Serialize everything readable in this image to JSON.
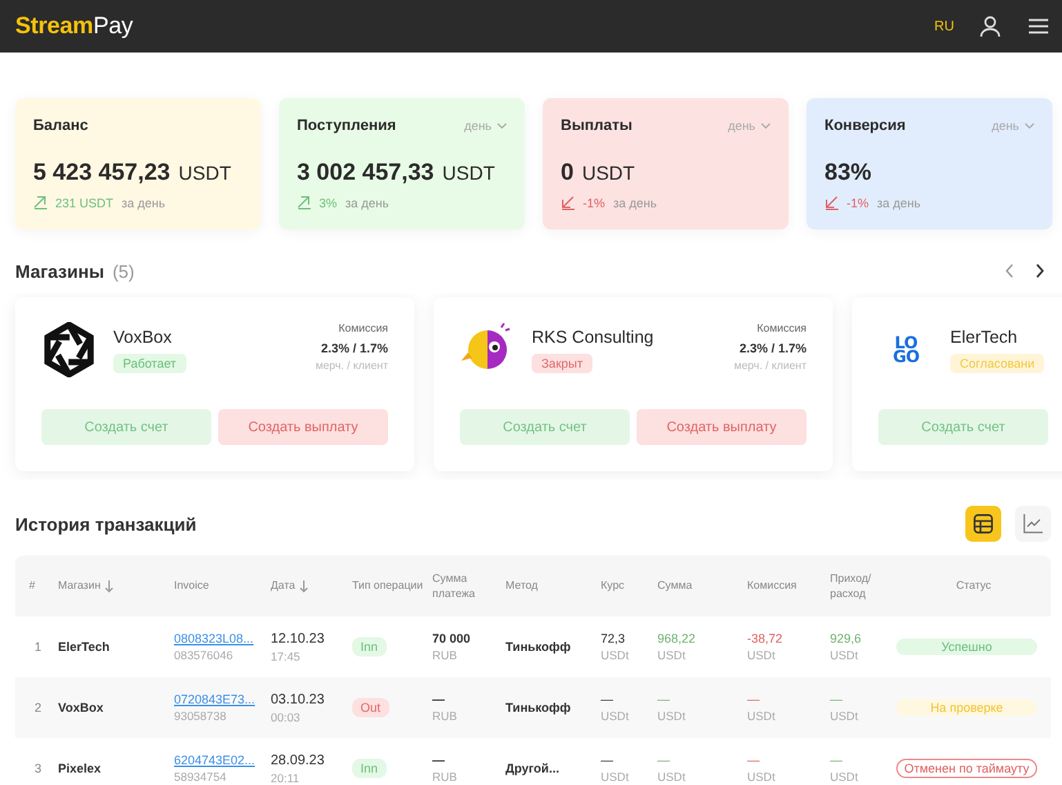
{
  "header": {
    "logo": {
      "part_1": "Stream",
      "part_2": "Pay"
    },
    "language": {
      "label": "RU",
      "selected": true
    }
  },
  "stats": [
    {
      "label": "Баланс",
      "color": "#fff8e3",
      "value": "5 423 457,23",
      "unit": "USDT",
      "kind": "up",
      "change": "231 USDT",
      "period_text": "за день"
    },
    {
      "label": "Поступления",
      "color": "#e8fbe6",
      "period": "день",
      "value": "3 002 457,33",
      "unit": "USDT",
      "kind": "up",
      "change": "3%",
      "period_text": "за день"
    },
    {
      "label": "Выплаты",
      "color": "#fde2e2",
      "period": "день",
      "value": "0",
      "unit": "USDT",
      "kind": "down",
      "change": "-1%",
      "period_text": "за день"
    },
    {
      "label": "Конверсия",
      "color": "#e1edfd",
      "period": "день",
      "value": "83%",
      "kind": "down",
      "change": "-1%",
      "period_text": "за день"
    }
  ],
  "stores": {
    "title": "Магазины",
    "count": "(5)",
    "items": [
      {
        "name": "VoxBox",
        "logo": {
          "kind": "aperture"
        },
        "status": {
          "label": "Работает",
          "kind": "active"
        },
        "commission_label": "Комиссия",
        "commission": "2.3% / 1.7%",
        "commission_note": "мерч. / клиент",
        "buttons": [
          {
            "label": "Создать счет",
            "kind": "invoice"
          },
          {
            "label": "Создать выплату",
            "kind": "payout"
          }
        ]
      },
      {
        "name": "RKS Consulting",
        "logo": {
          "kind": "parrot"
        },
        "status": {
          "label": "Закрыт",
          "kind": "closed"
        },
        "commission_label": "Комиссия",
        "commission": "2.3% / 1.7%",
        "commission_note": "мерч. / клиент",
        "buttons": [
          {
            "label": "Создать счет",
            "kind": "invoice"
          },
          {
            "label": "Создать выплату",
            "kind": "payout"
          }
        ]
      },
      {
        "name": "ElerTech",
        "logo": {
          "kind": "letters",
          "text": [
            "LO",
            "GO"
          ]
        },
        "status": {
          "label": "Согласовани",
          "kind": "pending"
        },
        "buttons": [
          {
            "label": "Создать счет",
            "kind": "invoice"
          }
        ]
      }
    ]
  },
  "transactions": {
    "title": "История транзакций",
    "views": [
      {
        "kind": "table",
        "selected": true
      },
      {
        "kind": "chart",
        "selected": false
      }
    ],
    "columns": [
      {
        "label": "#",
        "sortable": false
      },
      {
        "label": "Магазин",
        "sortable": true
      },
      {
        "label": "Invoice",
        "sortable": false
      },
      {
        "label": "Дата",
        "sortable": true
      },
      {
        "label": "Тип операции",
        "sortable": false
      },
      {
        "label": "Сумма платежа",
        "sortable": false
      },
      {
        "label": "Метод",
        "sortable": false
      },
      {
        "label": "Курс",
        "sortable": false
      },
      {
        "label": "Сумма",
        "sortable": false
      },
      {
        "label": "Комиссия",
        "sortable": false
      },
      {
        "label": "Приход/ расход",
        "sortable": false
      },
      {
        "label": "Статус",
        "sortable": false
      }
    ],
    "rows": [
      {
        "number": "1",
        "store": "ElerTech",
        "invoice": "0808323L08...",
        "invoice_sub": "083576046",
        "date": "12.10.23",
        "time": "17:45",
        "type": {
          "label": "Inn",
          "kind": "in"
        },
        "payment": "70 000",
        "payment_unit": "RUB",
        "method": "Тинькофф",
        "rate": "72,3",
        "rate_unit": "USDt",
        "amount": "968,22",
        "amount_unit": "USDt",
        "fee": "-38,72",
        "fee_unit": "USDt",
        "net": "929,6",
        "net_unit": "USDt",
        "status": {
          "label": "Успешно",
          "kind": "success"
        }
      },
      {
        "number": "2",
        "store": "VoxBox",
        "invoice": "0720843E73...",
        "invoice_sub": "93058738",
        "date": "03.10.23",
        "time": "00:03",
        "type": {
          "label": "Out",
          "kind": "out"
        },
        "payment": "—",
        "payment_unit": "RUB",
        "method": "Тинькофф",
        "rate": "—",
        "rate_unit": "USDt",
        "amount": "—",
        "amount_unit": "USDt",
        "fee": "—",
        "fee_unit": "USDt",
        "net": "—",
        "net_unit": "USDt",
        "status": {
          "label": "На проверке",
          "kind": "review"
        }
      },
      {
        "number": "3",
        "store": "Pixelex",
        "invoice": "6204743E02...",
        "invoice_sub": "58934754",
        "date": "28.09.23",
        "time": "20:11",
        "type": {
          "label": "Inn",
          "kind": "in"
        },
        "payment": "—",
        "payment_unit": "RUB",
        "method": "Другой...",
        "rate": "—",
        "rate_unit": "USDt",
        "amount": "—",
        "amount_unit": "USDt",
        "fee": "—",
        "fee_unit": "USDt",
        "net": "—",
        "net_unit": "USDt",
        "status": {
          "label": "Отменен по таймауту",
          "kind": "cancelled"
        }
      }
    ]
  }
}
